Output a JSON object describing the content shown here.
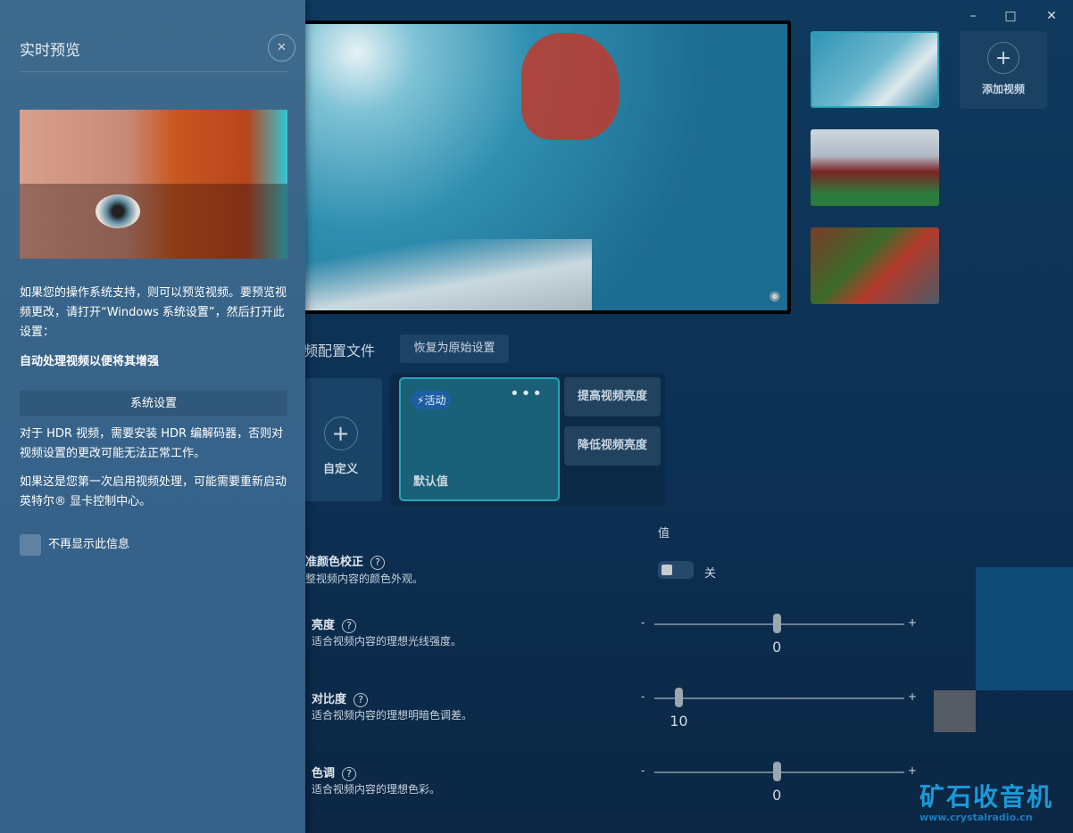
{
  "window": {
    "minimize_icon": "minimize-icon",
    "maximize_icon": "maximize-icon",
    "close_icon": "close-icon"
  },
  "preview_panel": {
    "title": "实时预览",
    "para1": "如果您的操作系统支持，则可以预览视频。要预览视频更改，请打开“Windows 系统设置”，然后打开此设置：",
    "bold_setting": "自动处理视频以便将其增强",
    "system_settings_button": "系统设置",
    "para2": "对于 HDR 视频，需要安装 HDR 编解码器，否则对视频设置的更改可能无法正常工作。",
    "para3": "如果这是您第一次启用视频处理，可能需要重新启动英特尔® 显卡控制中心。",
    "dont_show_label": "不再显示此信息",
    "dont_show_checked": false
  },
  "media": {
    "add_video_label": "添加视频"
  },
  "profiles": {
    "title_fragment": "频配置文件",
    "restore_button": "恢复为原始设置",
    "custom_label": "自定义",
    "active_badge": "活动",
    "default_label": "默认值",
    "preset_buttons": [
      "提高视频亮度",
      "降低视频亮度"
    ]
  },
  "settings": {
    "value_header": "值",
    "color_correction": {
      "label_fragment": "准颜色校正",
      "desc_fragment": "整视频内容的颜色外观。",
      "toggle_state": "关",
      "on": false
    },
    "sliders": [
      {
        "label": "亮度",
        "desc": "适合视频内容的理想光线强度。",
        "value": "0",
        "fraction": 0.5
      },
      {
        "label": "对比度",
        "desc": "适合视频内容的理想明暗色调差。",
        "value": "10",
        "fraction": 0.1
      },
      {
        "label": "色调",
        "desc": "适合视频内容的理想色彩。",
        "value": "0",
        "fraction": 0.5
      }
    ],
    "minus": "-",
    "plus": "+"
  },
  "watermark": {
    "text": "矿石收音机",
    "url": "www.crystalradio.cn"
  }
}
